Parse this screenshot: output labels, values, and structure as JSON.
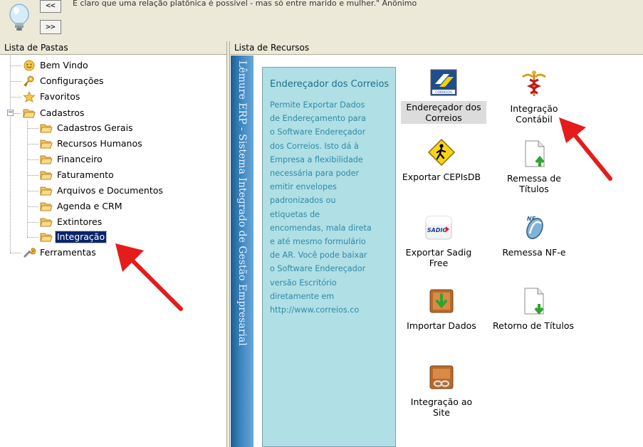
{
  "toolbar": {
    "prev_label": "<<",
    "next_label": ">>",
    "quote": "É claro que uma relação platônica é possível - mas só entre marido e mulher.\"  Anônimo"
  },
  "left_panel": {
    "title": "Lista de Pastas",
    "items": [
      {
        "label": "Bem Vindo",
        "icon": "smiley-icon"
      },
      {
        "label": "Configurações",
        "icon": "key-icon"
      },
      {
        "label": "Favoritos",
        "icon": "star-icon"
      },
      {
        "label": "Cadastros",
        "icon": "folder-open-icon"
      },
      {
        "label": "Cadastros Gerais",
        "icon": "folder-icon"
      },
      {
        "label": "Recursos Humanos",
        "icon": "folder-icon"
      },
      {
        "label": "Financeiro",
        "icon": "folder-icon"
      },
      {
        "label": "Faturamento",
        "icon": "folder-icon"
      },
      {
        "label": "Arquivos e Documentos",
        "icon": "folder-icon"
      },
      {
        "label": "Agenda e CRM",
        "icon": "folder-icon"
      },
      {
        "label": "Extintores",
        "icon": "folder-icon"
      },
      {
        "label": "Integração",
        "icon": "folder-icon",
        "selected": true
      },
      {
        "label": "Ferramentas",
        "icon": "wrench-icon"
      }
    ]
  },
  "right_panel": {
    "title": "Lista de Recursos",
    "banner": "Lêmure ERP - Sistema Integrado de Gestão Empresarial",
    "description": {
      "title": "Endereçador dos Correios",
      "body": "Permite Exportar Dados\nde Endereçamento para\no Software Endereçador\ndos Correios. Isto dá à\nEmpresa a flexibilidade\nnecessária para poder\nemitir envelopes\npadronizados ou\netiquetas de\nencomendas, mala direta\ne até mesmo formulário\nde AR. Você pode  baixar\no Software Endereçador\nversão Escritório\ndiretamente em\nhttp://www.correios.co"
    },
    "resources": [
      {
        "label": "Endereçador dos Correios",
        "icon": "correios-icon",
        "highlight": true
      },
      {
        "label": "Integração Contábil",
        "icon": "accounting-caduceus-icon"
      },
      {
        "label": "Exportar CEPIsDB",
        "icon": "pedestrian-sign-icon"
      },
      {
        "label": "Remessa de Títulos",
        "icon": "document-upload-icon"
      },
      {
        "label": "Exportar Sadig Free",
        "icon": "sadig-icon",
        "badge": "SADIG"
      },
      {
        "label": "Remessa NF-e",
        "icon": "nfe-icon",
        "badge": "NF"
      },
      {
        "label": "Importar Dados",
        "icon": "import-box-icon"
      },
      {
        "label": "Retorno de Títulos",
        "icon": "document-download-icon"
      },
      {
        "label": "Integração ao Site",
        "icon": "link-box-icon"
      }
    ]
  },
  "colors": {
    "arrow": "#e41c1c",
    "desc_bg": "#b0dfe5",
    "selection": "#0a246a",
    "banner": "#3d86bf"
  }
}
